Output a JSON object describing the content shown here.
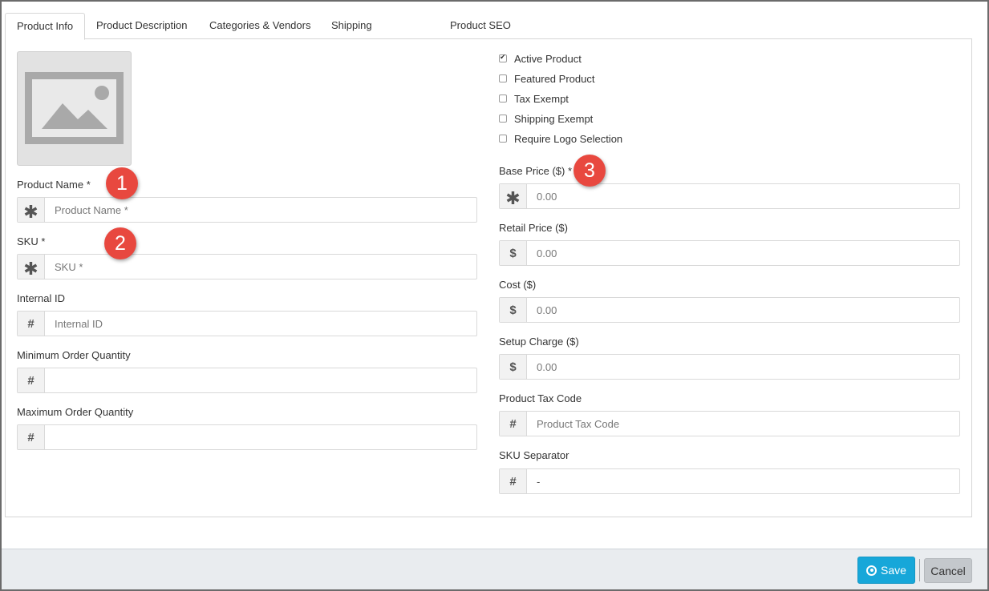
{
  "tabs": [
    {
      "label": "Product Info",
      "active": true
    },
    {
      "label": "Product Description"
    },
    {
      "label": "Categories & Vendors"
    },
    {
      "label": "Shipping"
    },
    {
      "label": "Product SEO"
    }
  ],
  "left": {
    "product_name": {
      "label": "Product Name *",
      "placeholder": "Product Name *",
      "icon": "asterisk"
    },
    "sku": {
      "label": "SKU *",
      "placeholder": "SKU *",
      "icon": "asterisk"
    },
    "internal_id": {
      "label": "Internal ID",
      "placeholder": "Internal ID",
      "icon": "#"
    },
    "min_qty": {
      "label": "Minimum Order Quantity",
      "placeholder": "",
      "icon": "#"
    },
    "max_qty": {
      "label": "Maximum Order Quantity",
      "placeholder": "",
      "icon": "#"
    }
  },
  "checkboxes": [
    {
      "label": "Active Product",
      "checked": true
    },
    {
      "label": "Featured Product",
      "checked": false
    },
    {
      "label": "Tax Exempt",
      "checked": false
    },
    {
      "label": "Shipping Exempt",
      "checked": false
    },
    {
      "label": "Require Logo Selection",
      "checked": false
    }
  ],
  "right": {
    "base_price": {
      "label": "Base Price ($) *",
      "placeholder": "0.00",
      "icon": "asterisk"
    },
    "retail_price": {
      "label": "Retail Price ($)",
      "placeholder": "0.00",
      "icon": "$"
    },
    "cost": {
      "label": "Cost ($)",
      "placeholder": "0.00",
      "icon": "$"
    },
    "setup_charge": {
      "label": "Setup Charge ($)",
      "placeholder": "0.00",
      "icon": "$"
    },
    "tax_code": {
      "label": "Product Tax Code",
      "placeholder": "Product Tax Code",
      "icon": "#"
    },
    "sku_separator": {
      "label": "SKU Separator",
      "value": "-",
      "icon": "#"
    }
  },
  "badges": [
    "1",
    "2",
    "3"
  ],
  "footer": {
    "save_label": "Save",
    "cancel_label": "Cancel"
  },
  "icons": {
    "asterisk": "✱",
    "hash": "#",
    "dollar": "$"
  },
  "colors": {
    "badge": "#e8483f",
    "save": "#17a7d9",
    "cancel": "#c4c8cc"
  }
}
